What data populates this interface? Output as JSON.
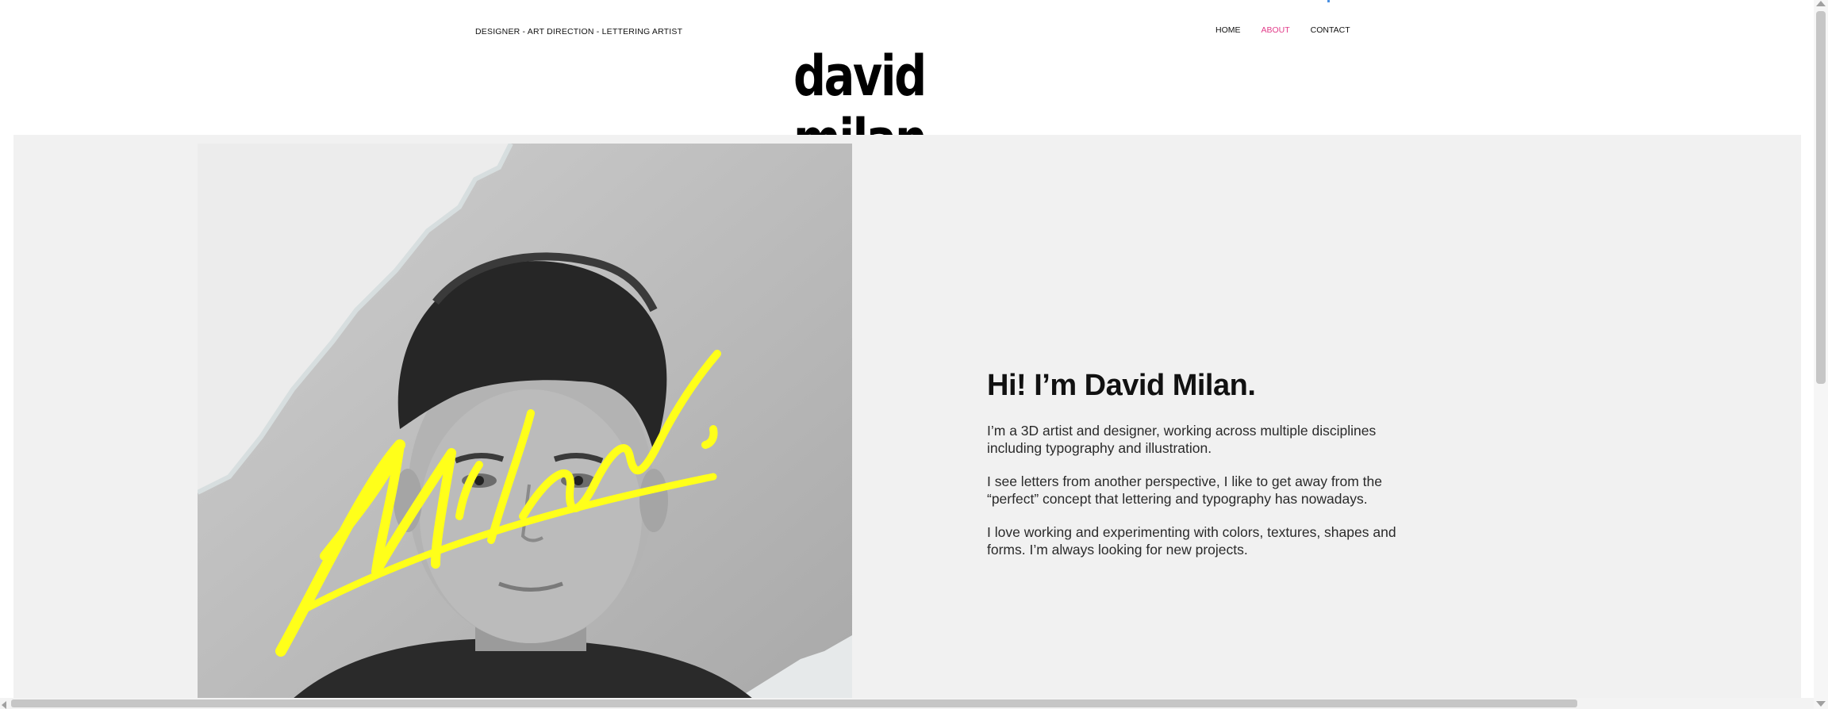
{
  "header": {
    "tagline": "DESIGNER - ART DIRECTION - LETTERING ARTIST",
    "logo": "david milan",
    "nav": [
      {
        "label": "HOME",
        "active": false
      },
      {
        "label": "ABOUT",
        "active": true
      },
      {
        "label": "CONTACT",
        "active": false
      }
    ]
  },
  "hero": {
    "photo_signature": "Milan.",
    "signature_color": "#ffff1a",
    "heading": "Hi! I’m David Milan.",
    "paragraphs": [
      "I’m a 3D artist and designer, working across multiple disciplines including typography and illustration.",
      "I see letters from another perspective, I like to get away from the “perfect” concept that lettering and typography has nowadays.",
      "I love working and experimenting with colors, textures, shapes and forms. I’m always looking for new projects."
    ]
  },
  "colors": {
    "accent_nav": "#e23d8a",
    "band_background": "#f1f1f1"
  }
}
